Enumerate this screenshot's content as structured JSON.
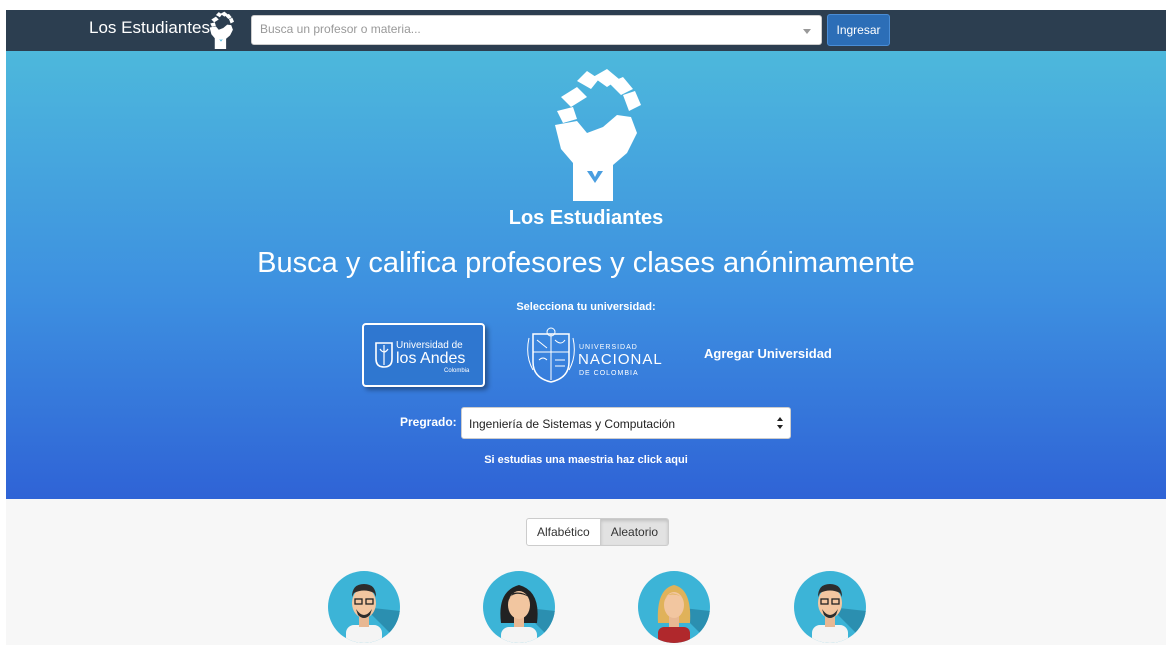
{
  "navbar": {
    "brand": "Los Estudiantes",
    "search_placeholder": "Busca un profesor o materia...",
    "login_label": "Ingresar"
  },
  "hero": {
    "brand": "Los Estudiantes",
    "title": "Busca y califica profesores y clases anónimamente",
    "select_university_label": "Selecciona tu universidad:",
    "universities": [
      {
        "line1": "Universidad de",
        "line2": "los Andes",
        "line3": "Colombia"
      },
      {
        "line1": "UNIVERSIDAD",
        "line2": "NACIONAL",
        "line3": "DE COLOMBIA"
      }
    ],
    "add_university": "Agregar Universidad",
    "program_label": "Pregrado:",
    "program_value": "Ingeniería de Sistemas y Computación",
    "masters_link": "Si estudias una maestria haz click aqui"
  },
  "sort": {
    "options": [
      "Alfabético",
      "Aleatorio"
    ],
    "selected": "Aleatorio"
  },
  "colors": {
    "navbar_bg": "#2c3e50",
    "accent": "#2c6eb7",
    "hero_top": "#4db8dc",
    "hero_bottom": "#2f63d6",
    "avatar_bg": "#3cb4d7"
  },
  "avatars": [
    "male-glasses-avatar",
    "female-dark-hair-avatar",
    "female-blonde-avatar",
    "male-glasses-avatar"
  ]
}
